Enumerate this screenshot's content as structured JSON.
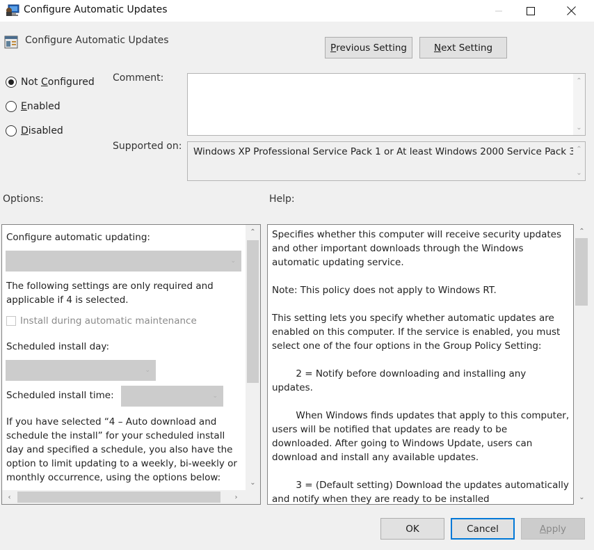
{
  "window": {
    "title": "Configure Automatic Updates",
    "controls": {
      "minimize": "minimize",
      "maximize": "maximize",
      "close": "close"
    }
  },
  "header": {
    "policy_title": "Configure Automatic Updates",
    "previous_setting": {
      "pre": "",
      "accel": "P",
      "post": "revious Setting"
    },
    "next_setting": {
      "pre": "",
      "accel": "N",
      "post": "ext Setting"
    }
  },
  "state": {
    "options": [
      {
        "pre": "Not ",
        "accel": "C",
        "post": "onfigured",
        "selected": true
      },
      {
        "pre": "",
        "accel": "E",
        "post": "nabled",
        "selected": false
      },
      {
        "pre": "",
        "accel": "D",
        "post": "isabled",
        "selected": false
      }
    ]
  },
  "comment": {
    "label": "Comment:",
    "value": ""
  },
  "supported": {
    "label": "Supported on:",
    "value": "Windows XP Professional Service Pack 1 or At least Windows 2000 Service Pack 3"
  },
  "options_pane": {
    "label": "Options:",
    "configure_label": "Configure automatic updating:",
    "configure_value": "",
    "note": "The following settings are only required and applicable if 4 is selected.",
    "maintenance_checkbox": {
      "label": "Install during automatic maintenance",
      "checked": false,
      "enabled": false
    },
    "install_day_label": "Scheduled install day:",
    "install_day_value": "",
    "install_time_label": "Scheduled install time:",
    "install_time_value": "",
    "schedule_note": "If you have selected “4 – Auto download and schedule the install” for your scheduled install day and specified a schedule, you also have the option to limit updating to a weekly, bi-weekly or monthly occurrence, using the options below:"
  },
  "help_pane": {
    "label": "Help:",
    "paragraphs": [
      "Specifies whether this computer will receive security updates and other important downloads through the Windows automatic updating service.",
      "Note: This policy does not apply to Windows RT.",
      "This setting lets you specify whether automatic updates are enabled on this computer. If the service is enabled, you must select one of the four options in the Group Policy Setting:",
      "        2 = Notify before downloading and installing any updates.",
      "        When Windows finds updates that apply to this computer, users will be notified that updates are ready to be downloaded. After going to Windows Update, users can download and install any available updates.",
      "        3 = (Default setting) Download the updates automatically and notify when they are ready to be installed"
    ]
  },
  "footer": {
    "ok": "OK",
    "cancel": "Cancel",
    "apply": {
      "pre": "",
      "accel": "A",
      "post": "pply"
    }
  },
  "colors": {
    "background": "#f0f0f0",
    "focus_border": "#0078d7",
    "disabled_fill": "#cccccc",
    "scroll_thumb": "#cdcdcd"
  }
}
